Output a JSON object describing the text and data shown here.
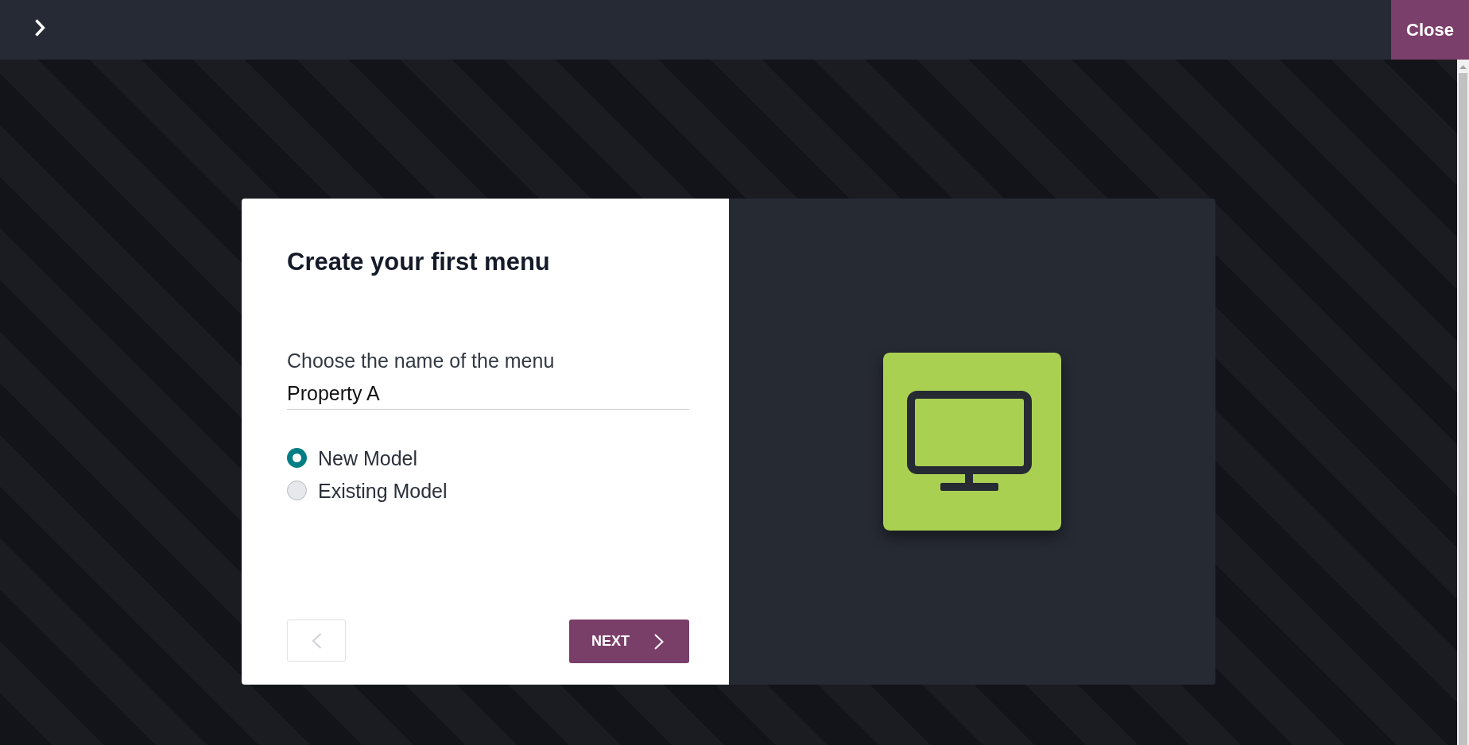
{
  "top_bar": {
    "close_label": "Close"
  },
  "dialog": {
    "title": "Create your first menu",
    "menu_name_field": {
      "label": "Choose the name of the menu",
      "value": "Property A"
    },
    "model_options": [
      {
        "label": "New Model",
        "selected": true
      },
      {
        "label": "Existing Model",
        "selected": false
      }
    ],
    "previous_button": {
      "disabled": true
    },
    "next_button": {
      "label": "NEXT"
    }
  }
}
